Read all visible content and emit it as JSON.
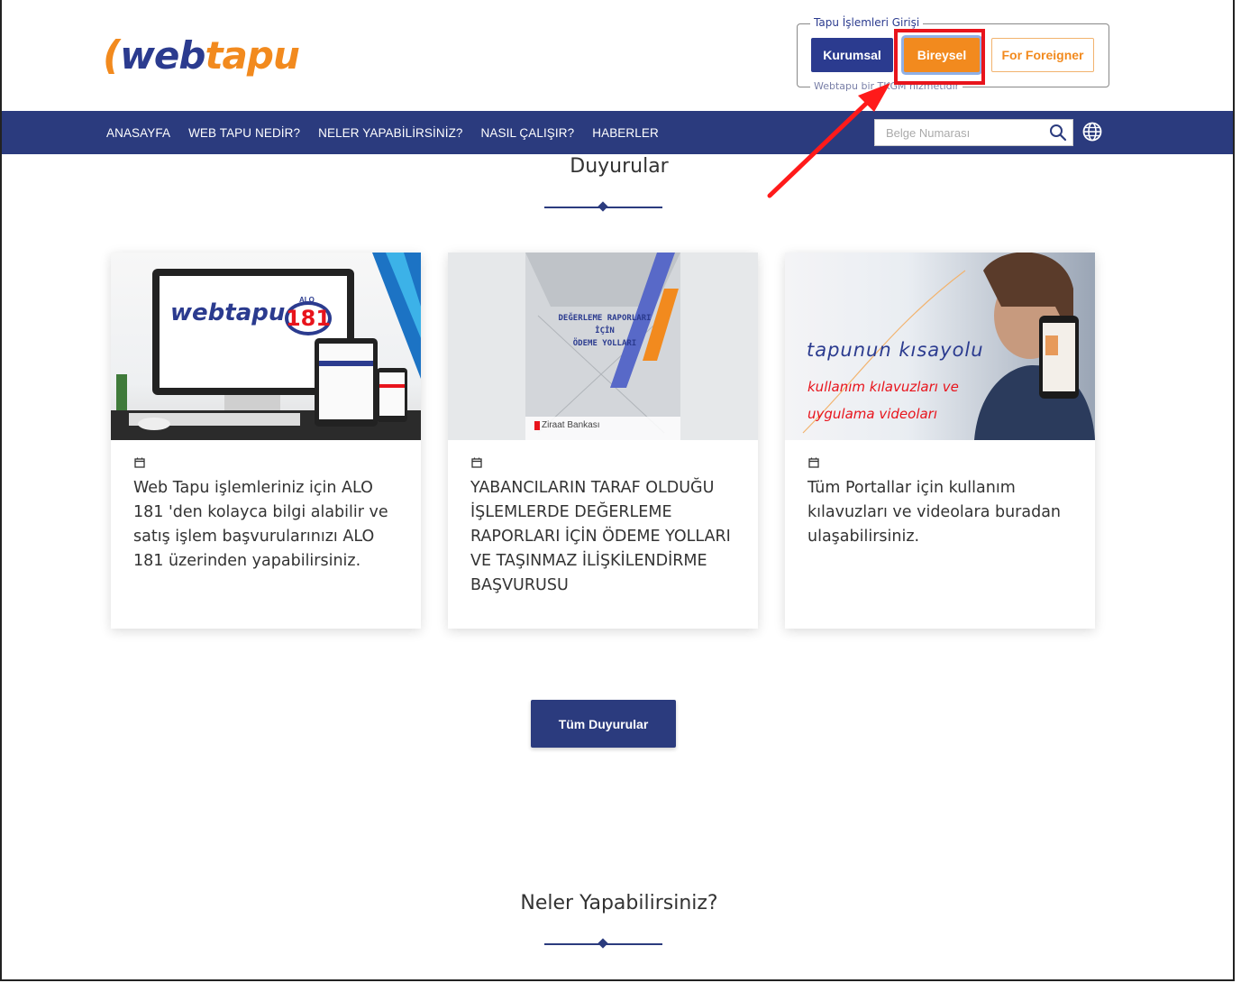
{
  "logo": {
    "mark": "(",
    "web": "web",
    "tapu": "tapu"
  },
  "login": {
    "legend": "Tapu İşlemleri Girişi",
    "footer": "Webtapu bir TKGM hizmetidir",
    "kurumsal": "Kurumsal",
    "bireysel": "Bireysel",
    "foreigner": "For Foreigner"
  },
  "nav": {
    "items": [
      "ANASAYFA",
      "WEB TAPU NEDİR?",
      "NELER YAPABİLİRSİNİZ?",
      "NASIL ÇALIŞIR?",
      "HABERLER"
    ],
    "search_placeholder": "Belge Numarası"
  },
  "announcements": {
    "title": "Duyurular",
    "cards": [
      {
        "text": "Web Tapu işlemleriniz için ALO 181 'den kolayca bilgi alabilir ve satış işlem başvurularınızı ALO 181 üzerinden yapabilirsiniz.",
        "image_text": [
          "webtapu",
          "181",
          "ALO"
        ]
      },
      {
        "text": "YABANCILARIN TARAF OLDUĞU İŞLEMLERDE DEĞERLEME RAPORLARI İÇİN ÖDEME YOLLARI VE TAŞINMAZ İLİŞKİLENDİRME BAŞVURUSU",
        "image_text": [
          "DEĞERLEME RAPORLARI",
          "İÇİN",
          "ÖDEME YOLLARI",
          "Ziraat Bankası"
        ]
      },
      {
        "text": "Tüm Portallar için kullanım kılavuzları ve videolara buradan ulaşabilirsiniz.",
        "image_text": [
          "tapunun kısayolu",
          "kullanım kılavuzları ve",
          "uygulama videoları"
        ]
      }
    ],
    "all_button": "Tüm Duyurular"
  },
  "features": {
    "title": "Neler Yapabilirsiniz?"
  },
  "colors": {
    "navy": "#2b3b7e",
    "orange": "#f28a1e",
    "highlight_red": "#e8141c"
  }
}
